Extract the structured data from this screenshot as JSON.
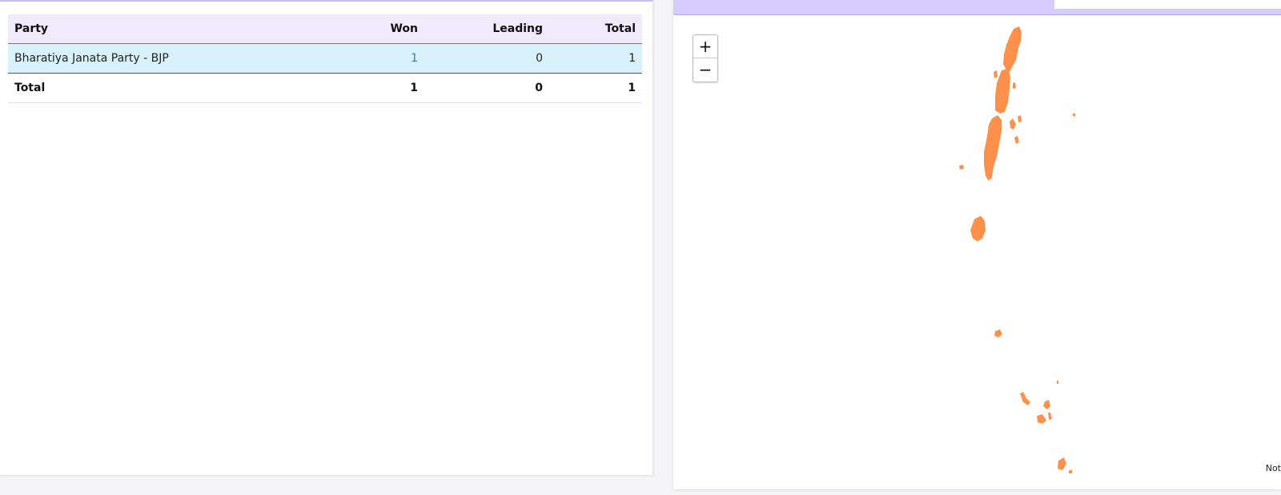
{
  "table": {
    "headers": {
      "party": "Party",
      "won": "Won",
      "leading": "Leading",
      "total": "Total"
    },
    "rows": [
      {
        "party": "Bharatiya Janata Party - BJP",
        "won": "1",
        "leading": "0",
        "total": "1"
      }
    ],
    "footer": {
      "label": "Total",
      "won": "1",
      "leading": "0",
      "total": "1"
    }
  },
  "map": {
    "zoom_in_label": "+",
    "zoom_out_label": "−",
    "fill_color": "#fd914c",
    "note_text": "Not"
  },
  "colors": {
    "header_bg": "#efebfd",
    "row_highlight": "#d8f2fb",
    "accent": "#d6cdfd"
  }
}
